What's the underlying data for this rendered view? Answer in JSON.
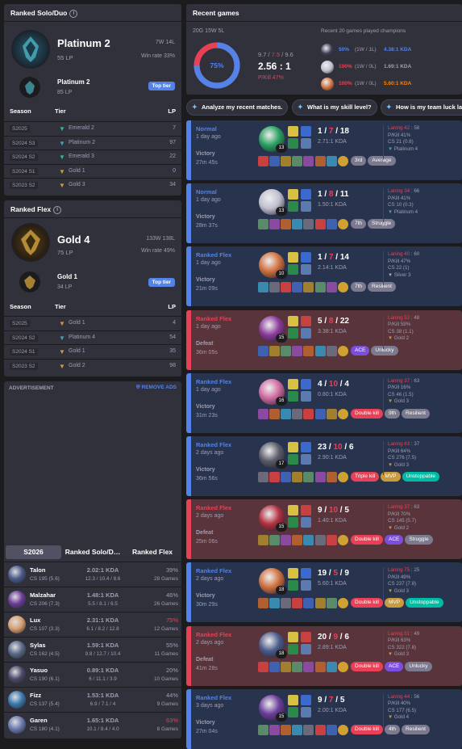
{
  "solo": {
    "title": "Ranked Solo/Duo",
    "tier": "Platinum 2",
    "lp": "55 LP",
    "wl": "7W 14L",
    "winrate": "Win rate 33%",
    "top_tier": "Platinum 2",
    "top_lp": "85 LP",
    "top_label": "Top tier",
    "headers": {
      "season": "Season",
      "tier": "Tier",
      "lp": "LP"
    },
    "seasons": [
      {
        "s": "S2025",
        "t": "Emerald 2",
        "lp": "7",
        "c": "#2dbd85"
      },
      {
        "s": "S2024 S3",
        "t": "Platinum 2",
        "lp": "97",
        "c": "#4a9fb0"
      },
      {
        "s": "S2024 S2",
        "t": "Emerald 3",
        "lp": "22",
        "c": "#2dbd85"
      },
      {
        "s": "S2024 S1",
        "t": "Gold 1",
        "lp": "0",
        "c": "#c89b3c"
      },
      {
        "s": "S2023 S2",
        "t": "Gold 3",
        "lp": "34",
        "c": "#c89b3c"
      }
    ]
  },
  "flex": {
    "title": "Ranked Flex",
    "tier": "Gold 4",
    "lp": "75 LP",
    "wl": "133W 138L",
    "winrate": "Win rate 49%",
    "top_tier": "Gold 1",
    "top_lp": "34 LP",
    "top_label": "Top tier",
    "headers": {
      "season": "Season",
      "tier": "Tier",
      "lp": "LP"
    },
    "seasons": [
      {
        "s": "S2025",
        "t": "Gold 1",
        "lp": "4",
        "c": "#c89b3c"
      },
      {
        "s": "S2024 S2",
        "t": "Platinum 4",
        "lp": "54",
        "c": "#4a9fb0"
      },
      {
        "s": "S2024 S1",
        "t": "Gold 1",
        "lp": "35",
        "c": "#c89b3c"
      },
      {
        "s": "S2023 S2",
        "t": "Gold 2",
        "lp": "98",
        "c": "#c89b3c"
      }
    ]
  },
  "ad": {
    "label": "ADVERTISEMENT",
    "remove": "REMOVE ADS"
  },
  "champ_tabs": [
    "S2026",
    "Ranked Solo/D…",
    "Ranked Flex"
  ],
  "champions": [
    {
      "n": "Talon",
      "cs": "CS 195 (5.6)",
      "kda": "2.02:1 KDA",
      "kd": "12.3 / 10.4 / 8.6",
      "wr": "39%",
      "g": "28 Games",
      "c": "#4b5a8a",
      "red": false
    },
    {
      "n": "Malzahar",
      "cs": "CS 206 (7.3)",
      "kda": "1.48:1 KDA",
      "kd": "5.5 / 8.1 / 6.5",
      "wr": "46%",
      "g": "26 Games",
      "c": "#6b3d9a",
      "red": false
    },
    {
      "n": "Lux",
      "cs": "CS 107 (3.3)",
      "kda": "2.31:1 KDA",
      "kd": "6.1 / 8.2 / 12.8",
      "wr": "75%",
      "g": "12 Games",
      "c": "#d8a070",
      "red": true
    },
    {
      "n": "Sylas",
      "cs": "CS 162 (4.5)",
      "kda": "1.59:1 KDA",
      "kd": "9.8 / 12.7 / 10.4",
      "wr": "55%",
      "g": "11 Games",
      "c": "#5a6a8a",
      "red": false
    },
    {
      "n": "Yasuo",
      "cs": "CS 190 (6.1)",
      "kda": "0.89:1 KDA",
      "kd": "6 / 11.1 / 3.9",
      "wr": "20%",
      "g": "10 Games",
      "c": "#4a4a6a",
      "red": false
    },
    {
      "n": "Fizz",
      "cs": "CS 137 (5.4)",
      "kda": "1.53:1 KDA",
      "kd": "6.9 / 7.1 / 4",
      "wr": "44%",
      "g": "9 Games",
      "c": "#3a7ab0",
      "red": false
    },
    {
      "n": "Garen",
      "cs": "CS 180 (4.1)",
      "kda": "1.65:1 KDA",
      "kd": "10.1 / 8.4 / 4.0",
      "wr": "63%",
      "g": "8 Games",
      "c": "#6a7ab0",
      "red": true
    }
  ],
  "recent": {
    "title": "Recent games",
    "record": "20G 15W 5L",
    "winrate": "75%",
    "kda_line": "9.7 / 7.5 / 9.6",
    "kda_k": "9.7",
    "kda_d": "7.5",
    "kda_a": "9.6",
    "kda_ratio": "2.56 : 1",
    "pkill": "P/Kill 47%",
    "champ_header": "Recent 20 games played champions",
    "champs": [
      {
        "p": "50%",
        "wl": "(1W / 1L)",
        "k": "4.38:1 KDA",
        "c": "#3b3b55",
        "pc": "#5383e8",
        "kc": "#5383e8"
      },
      {
        "p": "100%",
        "wl": "(1W / 0L)",
        "k": "1.69:1 KDA",
        "c": "#c0c0d0",
        "pc": "#e84057",
        "kc": "#9e9eb1"
      },
      {
        "p": "100%",
        "wl": "(1W / 0L)",
        "k": "5.60:1 KDA",
        "c": "#d07040",
        "pc": "#e84057",
        "kc": "#ff8200"
      }
    ]
  },
  "ask": [
    "Analyze my recent matches.",
    "What is my skill level?",
    "How is my team luck la"
  ],
  "matches": [
    {
      "w": true,
      "q": "Normal",
      "a": "1 day ago",
      "r": "Victory",
      "d": "27m 45s",
      "k": "1",
      "de": "7",
      "as": "18",
      "ratio": "2.71:1 KDA",
      "lv": "13",
      "lan": "Laning 42",
      "lan2": " : 58",
      "pk": "P/Kill 41%",
      "cs": "CS 21 (0.8)",
      "rank": "Platinum 4",
      "tags": [
        {
          "t": "3rd",
          "c": "tg"
        },
        {
          "t": "Average",
          "c": "tg"
        }
      ],
      "cc": "#2aa060"
    },
    {
      "w": true,
      "q": "Normal",
      "a": "1 day ago",
      "r": "Victory",
      "d": "28m 37s",
      "k": "1",
      "de": "8",
      "as": "11",
      "ratio": "1.50:1 KDA",
      "lv": "13",
      "lan": "Laning 34",
      "lan2": " : 66",
      "pk": "P/Kill 41%",
      "cs": "CS 10 (0.3)",
      "rank": "Platinum 4",
      "tags": [
        {
          "t": "7th",
          "c": "tg"
        },
        {
          "t": "Struggle",
          "c": "tg"
        }
      ],
      "cc": "#c0c0d0"
    },
    {
      "w": true,
      "q": "Ranked Flex",
      "a": "1 day ago",
      "r": "Victory",
      "d": "21m 09s",
      "k": "1",
      "de": "7",
      "as": "14",
      "ratio": "2.14:1 KDA",
      "lv": "10",
      "lan": "Laning 40",
      "lan2": " : 60",
      "pk": "P/Kill 47%",
      "cs": "CS 22 (1)",
      "rank": "Silver 3",
      "tags": [
        {
          "t": "7th",
          "c": "tg"
        },
        {
          "t": "Resilient",
          "c": "tg"
        }
      ],
      "cc": "#d07040"
    },
    {
      "w": false,
      "q": "Ranked Flex",
      "a": "1 day ago",
      "r": "Defeat",
      "d": "36m 05s",
      "k": "5",
      "de": "8",
      "as": "22",
      "ratio": "3.38:1 KDA",
      "lv": "15",
      "lan": "Laning 52",
      "lan2": " : 48",
      "pk": "P/Kill 59%",
      "cs": "CS 38 (1.1)",
      "rank": "Gold 2",
      "tags": [
        {
          "t": "ACE",
          "c": "tp"
        },
        {
          "t": "Unlucky",
          "c": "tg"
        }
      ],
      "cc": "#8a3a9a"
    },
    {
      "w": true,
      "q": "Ranked Flex",
      "a": "1 day ago",
      "r": "Victory",
      "d": "31m 23s",
      "k": "4",
      "de": "10",
      "as": "4",
      "ratio": "0.80:1 KDA",
      "lv": "16",
      "lan": "Laning 37",
      "lan2": " : 63",
      "pk": "P/Kill 16%",
      "cs": "CS 46 (1.5)",
      "rank": "Gold 3",
      "tags": [
        {
          "t": "Double kill",
          "c": "tr"
        },
        {
          "t": "9th",
          "c": "tg"
        },
        {
          "t": "Resilient",
          "c": "tg"
        }
      ],
      "cc": "#d06aa0"
    },
    {
      "w": true,
      "q": "Ranked Flex",
      "a": "2 days ago",
      "r": "Victory",
      "d": "36m 56s",
      "k": "23",
      "de": "10",
      "as": "6",
      "ratio": "2.90:1 KDA",
      "lv": "17",
      "lan": "Laning 63",
      "lan2": " : 37",
      "pk": "P/Kill 64%",
      "cs": "CS 276 (7.5)",
      "rank": "Gold 3",
      "tags": [
        {
          "t": "Triple kill",
          "c": "tr"
        },
        {
          "t": "MVP",
          "c": "to"
        },
        {
          "t": "Unstoppable",
          "c": "tgr"
        }
      ],
      "cc": "#5a5a6a"
    },
    {
      "w": false,
      "q": "Ranked Flex",
      "a": "2 days ago",
      "r": "Defeat",
      "d": "25m 06s",
      "k": "9",
      "de": "10",
      "as": "5",
      "ratio": "1.40:1 KDA",
      "lv": "15",
      "lan": "Laning 37",
      "lan2": " : 63",
      "pk": "P/Kill 70%",
      "cs": "CS 145 (5.7)",
      "rank": "Gold 2",
      "tags": [
        {
          "t": "Double kill",
          "c": "tr"
        },
        {
          "t": "ACE",
          "c": "tp"
        },
        {
          "t": "Struggle",
          "c": "tg"
        }
      ],
      "cc": "#b03040"
    },
    {
      "w": true,
      "q": "Ranked Flex",
      "a": "2 days ago",
      "r": "Victory",
      "d": "30m 29s",
      "k": "19",
      "de": "5",
      "as": "9",
      "ratio": "5.60:1 KDA",
      "lv": "18",
      "lan": "Laning 75",
      "lan2": " : 25",
      "pk": "P/Kill 49%",
      "cs": "CS 237 (7.8)",
      "rank": "Gold 3",
      "tags": [
        {
          "t": "Double kill",
          "c": "tr"
        },
        {
          "t": "MVP",
          "c": "to"
        },
        {
          "t": "Unstoppable",
          "c": "tgr"
        }
      ],
      "cc": "#d07040"
    },
    {
      "w": false,
      "q": "Ranked Flex",
      "a": "2 days ago",
      "r": "Defeat",
      "d": "41m 28s",
      "k": "20",
      "de": "9",
      "as": "6",
      "ratio": "2.89:1 KDA",
      "lv": "18",
      "lan": "Laning 51",
      "lan2": " : 49",
      "pk": "P/Kill 63%",
      "cs": "CS 322 (7.8)",
      "rank": "Gold 3",
      "tags": [
        {
          "t": "Double kill",
          "c": "tr"
        },
        {
          "t": "ACE",
          "c": "tp"
        },
        {
          "t": "Unlucky",
          "c": "tg"
        }
      ],
      "cc": "#4b5a8a"
    },
    {
      "w": true,
      "q": "Ranked Flex",
      "a": "3 days ago",
      "r": "Victory",
      "d": "27m 04s",
      "k": "9",
      "de": "7",
      "as": "5",
      "ratio": "2.00:1 KDA",
      "lv": "15",
      "lan": "Laning 44",
      "lan2": " : 56",
      "pk": "P/Kill 40%",
      "cs": "CS 177 (6.5)",
      "rank": "Gold 4",
      "tags": [
        {
          "t": "Double kill",
          "c": "tr"
        },
        {
          "t": "4th",
          "c": "tg"
        },
        {
          "t": "Resilient",
          "c": "tg"
        }
      ],
      "cc": "#6b3d9a"
    }
  ],
  "item_colors": [
    "#c84040",
    "#4060b0",
    "#a08030",
    "#5a8a6a",
    "#8a4aa0",
    "#b06030",
    "#3a8ab0",
    "#6a6a7a"
  ]
}
